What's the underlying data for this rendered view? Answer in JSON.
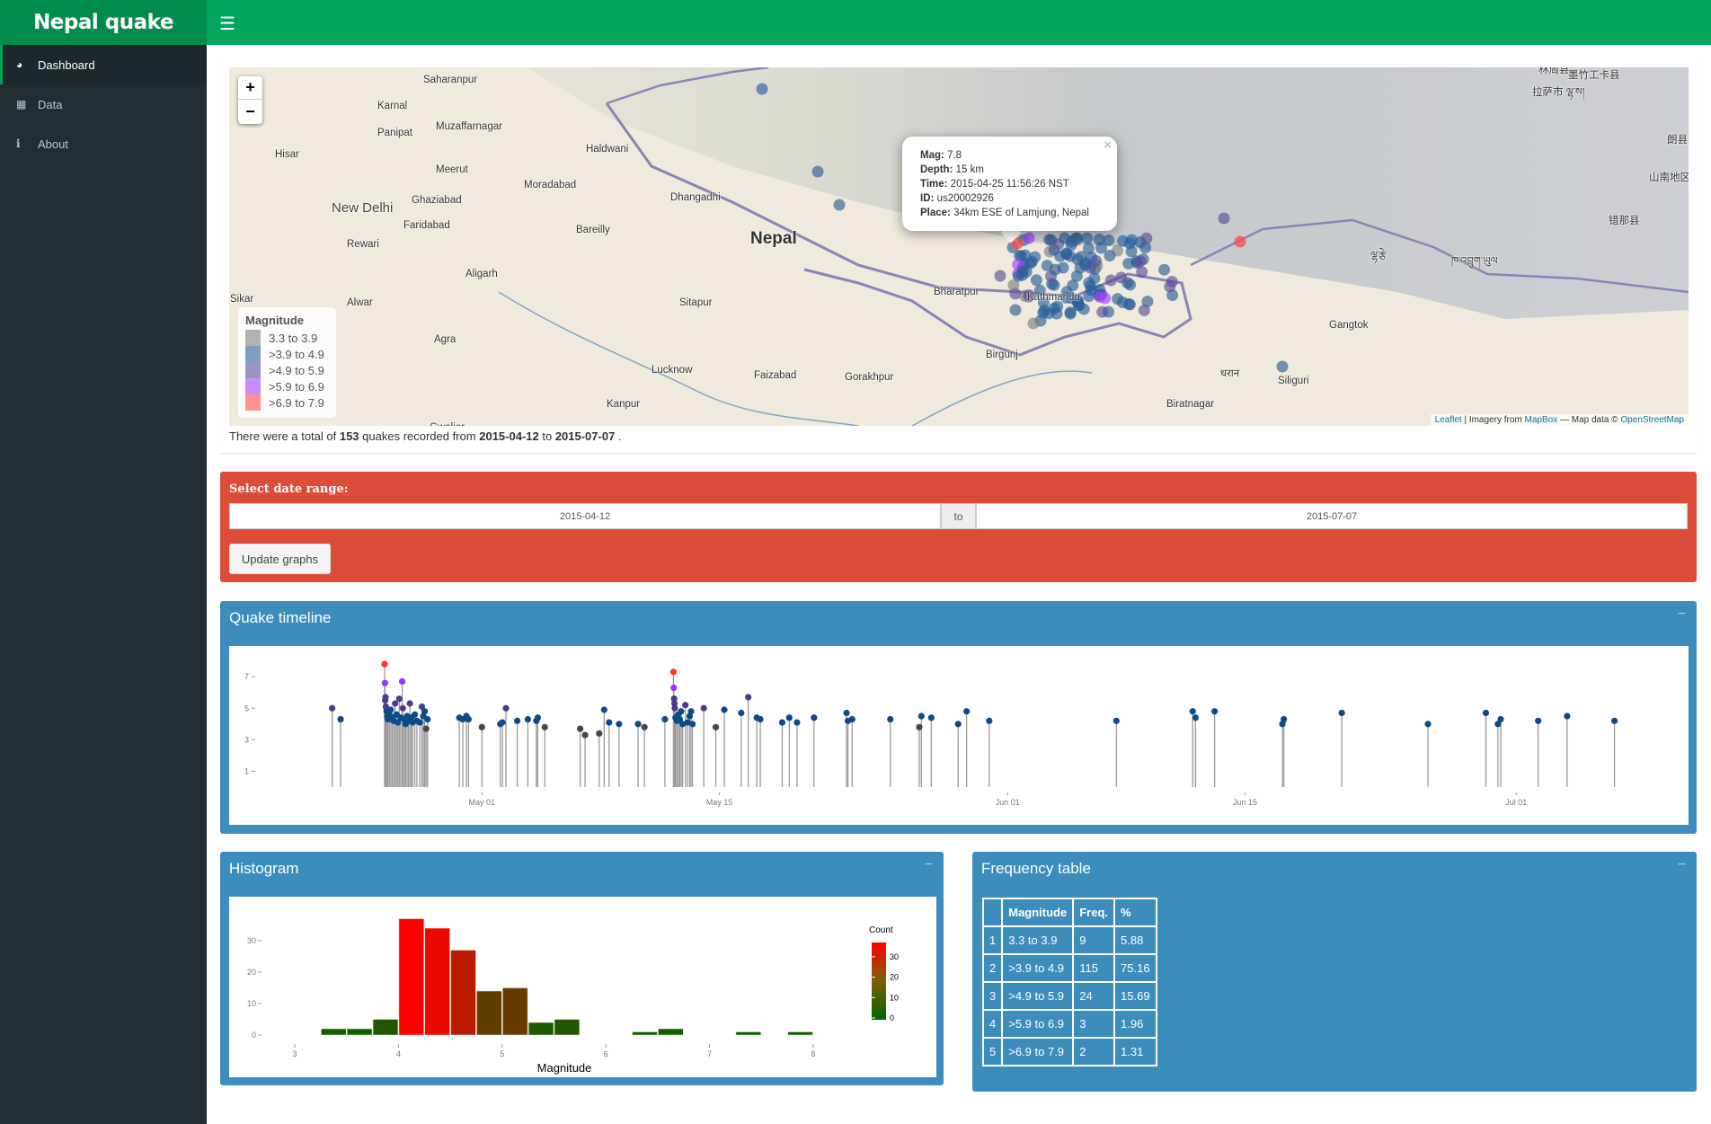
{
  "app": {
    "title": "Nepal quake",
    "menu_icon": "hamburger-icon"
  },
  "sidebar": {
    "items": [
      {
        "label": "Dashboard",
        "icon": "dashboard-icon",
        "active": true
      },
      {
        "label": "Data",
        "icon": "table-icon",
        "active": false
      },
      {
        "label": "About",
        "icon": "info-icon",
        "active": false
      }
    ]
  },
  "map": {
    "zoom_in": "+",
    "zoom_out": "−",
    "cities": [
      "Saharanpur",
      "Karnal",
      "Muzaffarnagar",
      "Panipat",
      "Hisar",
      "Haldwani",
      "Meerut",
      "Moradabad",
      "Dhangadhi",
      "New Delhi",
      "Ghaziabad",
      "Faridabad",
      "Bareilly",
      "Rewari",
      "Aligarh",
      "Sikar",
      "Alwar",
      "Sitapur",
      "Agra",
      "Lucknow",
      "Faizabad",
      "Gorakhpur",
      "Kanpur",
      "Gwalior",
      "Nepal",
      "Bharatpur",
      "Kathmandu",
      "Birgunj",
      "धरान",
      "Biratnagar",
      "Siliguri",
      "Gangtok",
      "林周县",
      "墨竹工卡县",
      "拉萨市 ལྷ་ས།",
      "朗县",
      "山南地区",
      "错那县",
      "ལྷ་རྩེ",
      "ཁ་འབྲུག་ཡུལ"
    ],
    "legend": {
      "title": "Magnitude",
      "items": [
        {
          "label": "3.3 to 3.9",
          "color": "#7f7f7f"
        },
        {
          "label": ">3.9 to 4.9",
          "color": "#2a5f9b"
        },
        {
          "label": ">4.9 to 5.9",
          "color": "#5b4f96"
        },
        {
          "label": ">5.9 to 6.9",
          "color": "#a640ff"
        },
        {
          "label": ">6.9 to 7.9",
          "color": "#ff4a4a"
        }
      ]
    },
    "popup": {
      "mag_label": "Mag:",
      "mag": "7.8",
      "depth_label": "Depth:",
      "depth": "15 km",
      "time_label": "Time:",
      "time": "2015-04-25 11:56:26 NST",
      "id_label": "ID:",
      "id": "us20002926",
      "place_label": "Place:",
      "place": "34km ESE of Lamjung, Nepal",
      "close": "×"
    },
    "attribution": {
      "leaflet": "Leaflet",
      "sep1": " | Imagery from ",
      "mapbox": "MapBox",
      "sep2": " — Map data © ",
      "osm": "OpenStreetMap"
    }
  },
  "summary": {
    "prefix": "There were a total of ",
    "count": "153",
    "mid1": " quakes recorded from ",
    "from": "2015-04-12",
    "mid2": " to ",
    "to": "2015-07-07",
    "suffix": " ."
  },
  "date_range": {
    "label": "Select date range:",
    "start": "2015-04-12",
    "separator": "to",
    "end": "2015-07-07",
    "button": "Update graphs"
  },
  "timeline": {
    "title": "Quake timeline",
    "collapse": "−"
  },
  "histogram": {
    "title": "Histogram",
    "collapse": "−"
  },
  "frequency": {
    "title": "Frequency table",
    "collapse": "−",
    "headers": [
      "",
      "Magnitude",
      "Freq.",
      "%"
    ],
    "rows": [
      [
        "1",
        "3.3 to 3.9",
        "9",
        "5.88"
      ],
      [
        "2",
        ">3.9 to 4.9",
        "115",
        "75.16"
      ],
      [
        "3",
        ">4.9 to 5.9",
        "24",
        "15.69"
      ],
      [
        "4",
        ">5.9 to 6.9",
        "3",
        "1.96"
      ],
      [
        "5",
        ">6.9 to 7.9",
        "2",
        "1.31"
      ]
    ]
  },
  "chart_data": [
    {
      "type": "line",
      "subtype": "lollipop",
      "title": "",
      "xlabel": "",
      "ylabel": "",
      "xlim": [
        "2015-04-18",
        "2015-07-11"
      ],
      "ylim": [
        0,
        8
      ],
      "x_ticks": [
        "May 01",
        "May 15",
        "Jun 01",
        "Jun 15",
        "Jul 01"
      ],
      "x_tick_dates": [
        "2015-05-01",
        "2015-05-15",
        "2015-06-01",
        "2015-06-15",
        "2015-07-01"
      ],
      "y_ticks": [
        1,
        3,
        5,
        7
      ],
      "color_bins": [
        {
          "max": 3.9,
          "color": "#474747"
        },
        {
          "max": 4.9,
          "color": "#0d4a8a"
        },
        {
          "max": 5.9,
          "color": "#4b3a8c"
        },
        {
          "max": 6.9,
          "color": "#9b30ff"
        },
        {
          "max": 7.9,
          "color": "#ff3030"
        }
      ],
      "points": [
        [
          "2015-04-22T04:00",
          5.0
        ],
        [
          "2015-04-22T16:00",
          4.3
        ],
        [
          "2015-04-25T06:11",
          7.8
        ],
        [
          "2015-04-25T06:45",
          6.6
        ],
        [
          "2015-04-25T07:00",
          5.5
        ],
        [
          "2015-04-25T07:30",
          5.7
        ],
        [
          "2015-04-25T08:00",
          5.1
        ],
        [
          "2015-04-25T09:00",
          4.8
        ],
        [
          "2015-04-25T10:00",
          4.5
        ],
        [
          "2015-04-25T11:00",
          4.3
        ],
        [
          "2015-04-25T13:00",
          4.6
        ],
        [
          "2015-04-25T15:00",
          4.9
        ],
        [
          "2015-04-25T17:00",
          4.4
        ],
        [
          "2015-04-25T19:00",
          4.2
        ],
        [
          "2015-04-25T21:00",
          5.3
        ],
        [
          "2015-04-25T23:00",
          4.6
        ],
        [
          "2015-04-26T01:00",
          4.1
        ],
        [
          "2015-04-26T03:00",
          5.6
        ],
        [
          "2015-04-26T05:00",
          4.4
        ],
        [
          "2015-04-26T07:09",
          6.7
        ],
        [
          "2015-04-26T08:00",
          5.0
        ],
        [
          "2015-04-26T10:00",
          4.3
        ],
        [
          "2015-04-26T12:00",
          4.0
        ],
        [
          "2015-04-26T14:00",
          4.5
        ],
        [
          "2015-04-26T16:00",
          4.2
        ],
        [
          "2015-04-26T18:00",
          5.3
        ],
        [
          "2015-04-26T20:00",
          4.4
        ],
        [
          "2015-04-26T22:00",
          4.1
        ],
        [
          "2015-04-27T01:00",
          4.6
        ],
        [
          "2015-04-27T04:00",
          4.2
        ],
        [
          "2015-04-27T08:00",
          4.1
        ],
        [
          "2015-04-27T11:00",
          5.1
        ],
        [
          "2015-04-27T13:00",
          4.5
        ],
        [
          "2015-04-27T15:00",
          4.8
        ],
        [
          "2015-04-27T17:00",
          3.7
        ],
        [
          "2015-04-27T19:00",
          4.3
        ],
        [
          "2015-04-29T16:00",
          4.4
        ],
        [
          "2015-04-29T21:00",
          4.3
        ],
        [
          "2015-04-30T02:00",
          4.5
        ],
        [
          "2015-04-30T05:00",
          4.3
        ],
        [
          "2015-05-01T00:00",
          3.8
        ],
        [
          "2015-05-02T02:00",
          4.0
        ],
        [
          "2015-05-02T05:00",
          4.1
        ],
        [
          "2015-05-02T10:00",
          5.0
        ],
        [
          "2015-05-03T02:00",
          4.2
        ],
        [
          "2015-05-03T17:00",
          4.3
        ],
        [
          "2015-05-04T05:00",
          4.2
        ],
        [
          "2015-05-04T07:00",
          4.4
        ],
        [
          "2015-05-04T17:00",
          3.8
        ],
        [
          "2015-05-06T19:00",
          3.7
        ],
        [
          "2015-05-07T02:00",
          3.3
        ],
        [
          "2015-05-07T22:00",
          3.4
        ],
        [
          "2015-05-08T05:00",
          4.9
        ],
        [
          "2015-05-08T12:00",
          4.1
        ],
        [
          "2015-05-09T02:00",
          4.0
        ],
        [
          "2015-05-10T05:00",
          4.0
        ],
        [
          "2015-05-10T14:00",
          3.8
        ],
        [
          "2015-05-11T19:00",
          4.3
        ],
        [
          "2015-05-12T07:05",
          7.3
        ],
        [
          "2015-05-12T07:30",
          6.3
        ],
        [
          "2015-05-12T08:00",
          5.6
        ],
        [
          "2015-05-12T08:30",
          5.3
        ],
        [
          "2015-05-12T09:00",
          5.0
        ],
        [
          "2015-05-12T10:00",
          4.4
        ],
        [
          "2015-05-12T12:00",
          4.2
        ],
        [
          "2015-05-12T14:00",
          4.6
        ],
        [
          "2015-05-12T16:00",
          4.3
        ],
        [
          "2015-05-12T18:00",
          4.8
        ],
        [
          "2015-05-12T20:00",
          4.0
        ],
        [
          "2015-05-13T00:00",
          5.2
        ],
        [
          "2015-05-13T03:00",
          4.1
        ],
        [
          "2015-05-13T06:00",
          4.5
        ],
        [
          "2015-05-13T08:00",
          4.8
        ],
        [
          "2015-05-13T10:00",
          4.0
        ],
        [
          "2015-05-14T02:00",
          5.0
        ],
        [
          "2015-05-14T19:00",
          3.8
        ],
        [
          "2015-05-15T07:00",
          4.9
        ],
        [
          "2015-05-16T07:00",
          4.7
        ],
        [
          "2015-05-16T17:00",
          5.7
        ],
        [
          "2015-05-17T05:00",
          4.4
        ],
        [
          "2015-05-17T10:00",
          4.3
        ],
        [
          "2015-05-18T17:00",
          4.1
        ],
        [
          "2015-05-19T03:00",
          4.4
        ],
        [
          "2015-05-19T14:00",
          4.1
        ],
        [
          "2015-05-20T14:00",
          4.4
        ],
        [
          "2015-05-22T12:00",
          4.7
        ],
        [
          "2015-05-22T14:00",
          4.2
        ],
        [
          "2015-05-22T20:00",
          4.3
        ],
        [
          "2015-05-25T02:00",
          4.3
        ],
        [
          "2015-05-26T19:00",
          3.8
        ],
        [
          "2015-05-26T22:00",
          4.5
        ],
        [
          "2015-05-27T12:00",
          4.4
        ],
        [
          "2015-05-29T02:00",
          4.0
        ],
        [
          "2015-05-29T14:00",
          4.8
        ],
        [
          "2015-05-30T22:00",
          4.2
        ],
        [
          "2015-06-07T10:00",
          4.2
        ],
        [
          "2015-06-11T22:00",
          4.8
        ],
        [
          "2015-06-12T02:00",
          4.4
        ],
        [
          "2015-06-13T05:00",
          4.8
        ],
        [
          "2015-06-17T05:00",
          4.0
        ],
        [
          "2015-06-17T07:00",
          4.3
        ],
        [
          "2015-06-20T17:00",
          4.7
        ],
        [
          "2015-06-25T19:00",
          4.0
        ],
        [
          "2015-06-29T05:00",
          4.7
        ],
        [
          "2015-06-29T22:00",
          4.0
        ],
        [
          "2015-06-30T02:00",
          4.3
        ],
        [
          "2015-07-02T07:00",
          4.2
        ],
        [
          "2015-07-04T00:00",
          4.5
        ],
        [
          "2015-07-06T19:00",
          4.2
        ]
      ]
    },
    {
      "type": "bar",
      "subtype": "histogram",
      "title": "",
      "xlabel": "Magnitude",
      "ylabel": "",
      "xlim": [
        2.9,
        8.3
      ],
      "ylim": [
        0,
        40
      ],
      "x_ticks": [
        3,
        4,
        5,
        6,
        7,
        8
      ],
      "y_ticks": [
        0,
        10,
        20,
        30
      ],
      "bin_width": 0.25,
      "bins": [
        [
          3.25,
          2
        ],
        [
          3.5,
          2
        ],
        [
          3.75,
          5
        ],
        [
          4.0,
          37
        ],
        [
          4.25,
          34
        ],
        [
          4.5,
          27
        ],
        [
          4.75,
          14
        ],
        [
          5.0,
          15
        ],
        [
          5.25,
          4
        ],
        [
          5.5,
          5
        ],
        [
          6.25,
          1
        ],
        [
          6.5,
          2
        ],
        [
          7.25,
          1
        ],
        [
          7.75,
          1
        ]
      ],
      "legend": {
        "title": "Count",
        "ticks": [
          0,
          10,
          20,
          30
        ],
        "low_color": "#006400",
        "high_color": "#ff0000",
        "placement": "right"
      }
    }
  ]
}
